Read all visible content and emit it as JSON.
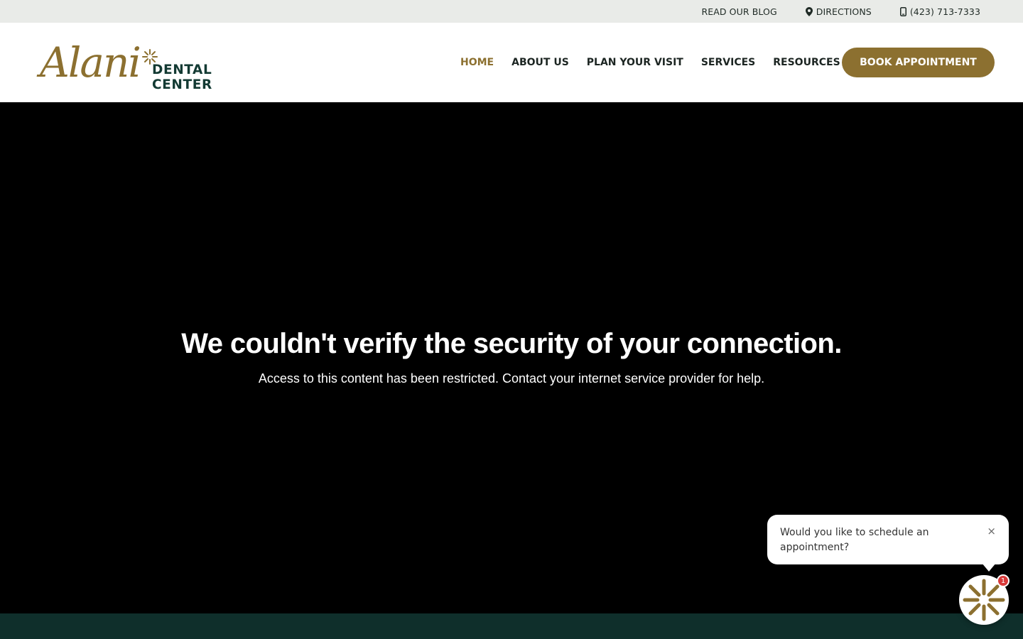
{
  "topbar": {
    "blog_label": "READ OUR BLOG",
    "directions_label": "DIRECTIONS",
    "phone_label": "(423) 713-7333",
    "pin_icon": "map-pin-icon",
    "phone_icon": "mobile-phone-icon"
  },
  "logo": {
    "script_text": "Alani",
    "wordmark": "DENTAL CENTER"
  },
  "nav": {
    "items": [
      {
        "label": "HOME",
        "active": true
      },
      {
        "label": "ABOUT US",
        "active": false
      },
      {
        "label": "PLAN YOUR VISIT",
        "active": false
      },
      {
        "label": "SERVICES",
        "active": false
      },
      {
        "label": "RESOURCES",
        "active": false
      }
    ],
    "book_label": "BOOK APPOINTMENT"
  },
  "hero": {
    "title": "We couldn't verify the security of your connection.",
    "message": "Access to this content has been restricted. Contact your internet service provider for help."
  },
  "chat": {
    "message": "Would you like to schedule an appointment?",
    "close_glyph": "×",
    "badge_count": "1",
    "launcher_icon": "sparkle-burst-icon"
  },
  "colors": {
    "brand_gold": "#8c7030",
    "brand_green": "#133a33",
    "topbar_bg": "#e9ebe8",
    "footer_bg": "#0f2f2b",
    "badge_red": "#d93a3a"
  }
}
